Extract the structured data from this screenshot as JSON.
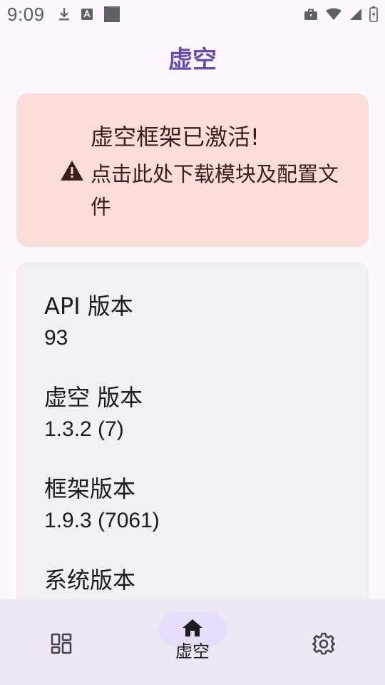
{
  "status_bar": {
    "time": "9:09",
    "left_icons": [
      "download-icon",
      "font-notification-icon",
      "square-notification-icon"
    ],
    "right_icons": [
      "work-profile-icon",
      "wifi-icon",
      "signal-icon",
      "battery-icon"
    ]
  },
  "app": {
    "title": "虚空"
  },
  "warning": {
    "icon": "warning-icon",
    "title": "虚空框架已激活!",
    "subtitle": "点击此处下载模块及配置文件",
    "colors": {
      "background": "#f8ddd9",
      "text": "#3a1f1c"
    }
  },
  "info": {
    "items": [
      {
        "label": "API 版本",
        "value": "93"
      },
      {
        "label": "虚空 版本",
        "value": "1.3.2 (7)"
      },
      {
        "label": "框架版本",
        "value": "1.9.3 (7061)"
      },
      {
        "label": "系统版本",
        "value": ""
      }
    ]
  },
  "bottom_nav": {
    "items": [
      {
        "icon": "modules-grid-icon",
        "label": "",
        "selected": false
      },
      {
        "icon": "home-icon",
        "label": "虚空",
        "selected": true
      },
      {
        "icon": "gear-icon",
        "label": "",
        "selected": false
      }
    ]
  },
  "theme": {
    "accent": "#6a4fa8",
    "nav_background": "#eee8f4",
    "nav_indicator": "#e6ddf8"
  }
}
